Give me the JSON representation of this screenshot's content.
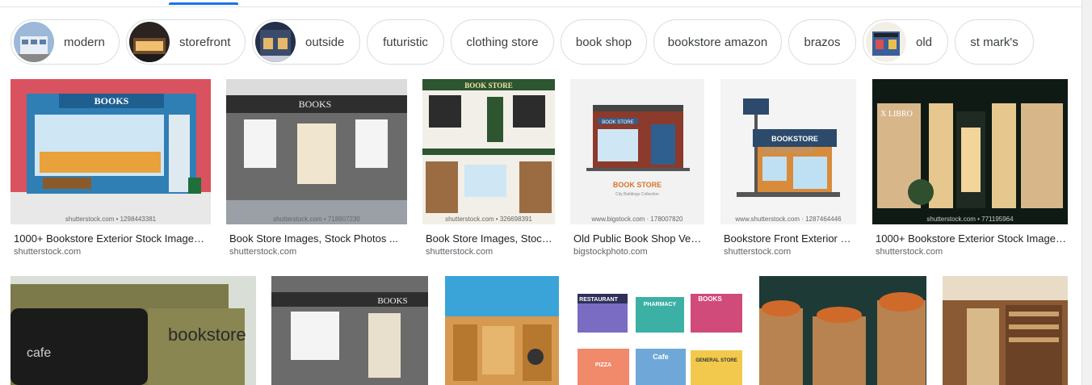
{
  "chips": [
    {
      "label": "modern",
      "thumb": "modern-building-thumb"
    },
    {
      "label": "storefront",
      "thumb": "storefront-thumb"
    },
    {
      "label": "outside",
      "thumb": "outside-thumb"
    },
    {
      "label": "futuristic"
    },
    {
      "label": "clothing store"
    },
    {
      "label": "book shop"
    },
    {
      "label": "bookstore amazon"
    },
    {
      "label": "brazos"
    },
    {
      "label": "old",
      "thumb": "old-store-thumb"
    },
    {
      "label": "st mark's"
    }
  ],
  "results_row1": [
    {
      "title": "1000+ Bookstore Exterior Stock Images ...",
      "source": "shutterstock.com",
      "watermark": "shutterstock.com • 1298443381",
      "sign": "BOOKS"
    },
    {
      "title": "Book Store Images, Stock Photos ...",
      "source": "shutterstock.com",
      "watermark": "shutterstock.com • 718907230",
      "sign": "BOOKS"
    },
    {
      "title": "Book Store Images, Stock ...",
      "source": "shutterstock.com",
      "watermark": "shutterstock.com • 326698391",
      "sign": "BOOK STORE"
    },
    {
      "title": "Old Public Book Shop Vect...",
      "source": "bigstockphoto.com",
      "watermark": "www.bigstock.com · 178007820",
      "sign": "BOOK STORE",
      "caption": "BOOK STORE",
      "subcaption": "City Buildings Collection"
    },
    {
      "title": "Bookstore Front Exterior De...",
      "source": "shutterstock.com",
      "watermark": "www.shutterstock.com · 1287464446",
      "sign": "BOOKSTORE",
      "overlay": "shutterstock"
    },
    {
      "title": "1000+ Bookstore Exterior Stock Images ...",
      "source": "shutterstock.com",
      "watermark": "shutterstock.com • 771195964",
      "sign": "X LIBRO"
    }
  ],
  "results_row2": [
    {
      "sign": "bookstore",
      "sign2": "cafe"
    },
    {
      "sign": "BOOKS"
    },
    {},
    {
      "signs": [
        "RESTAURANT",
        "PHARMACY",
        "BOOKS",
        "PIZZA",
        "Cafe",
        "GENERAL STORE"
      ]
    },
    {},
    {}
  ],
  "colors": {
    "accent": "#1a73e8",
    "chip_border": "#dadce0"
  }
}
